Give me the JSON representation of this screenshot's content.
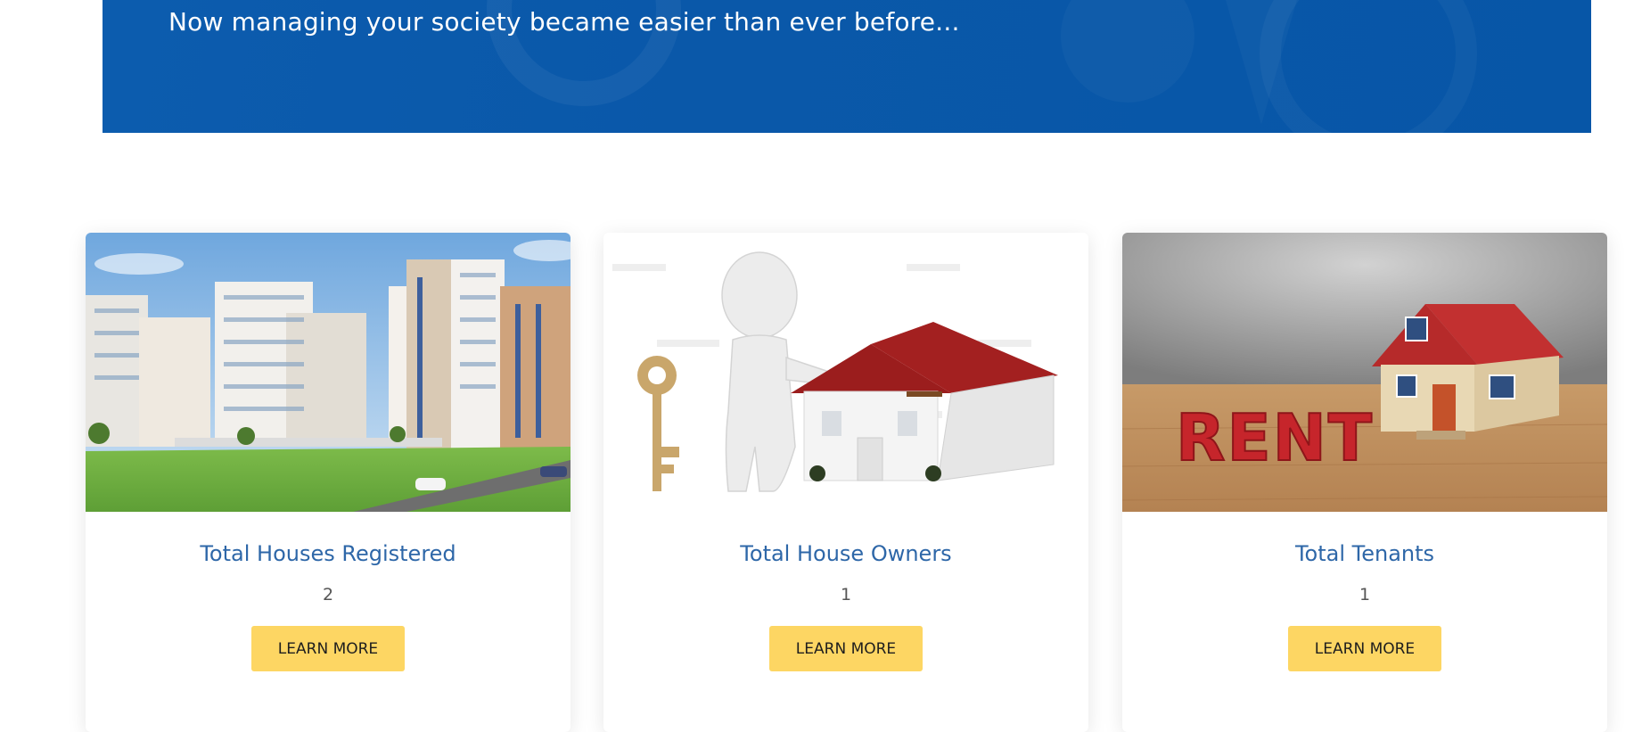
{
  "hero": {
    "tagline": "Now managing your society became easier than ever before..."
  },
  "cards": [
    {
      "title": "Total Houses Registered",
      "value": "2",
      "button_label": "LEARN MORE",
      "image": "apartment-buildings-image"
    },
    {
      "title": "Total House Owners",
      "value": "1",
      "button_label": "LEARN MORE",
      "image": "figure-with-key-and-house-image"
    },
    {
      "title": "Total Tenants",
      "value": "1",
      "button_label": "LEARN MORE",
      "image": "rent-letters-and-house-image"
    }
  ],
  "colors": {
    "hero_blue": "#0a58a9",
    "title_blue": "#2e67a8",
    "button_yellow": "#fdd663"
  }
}
